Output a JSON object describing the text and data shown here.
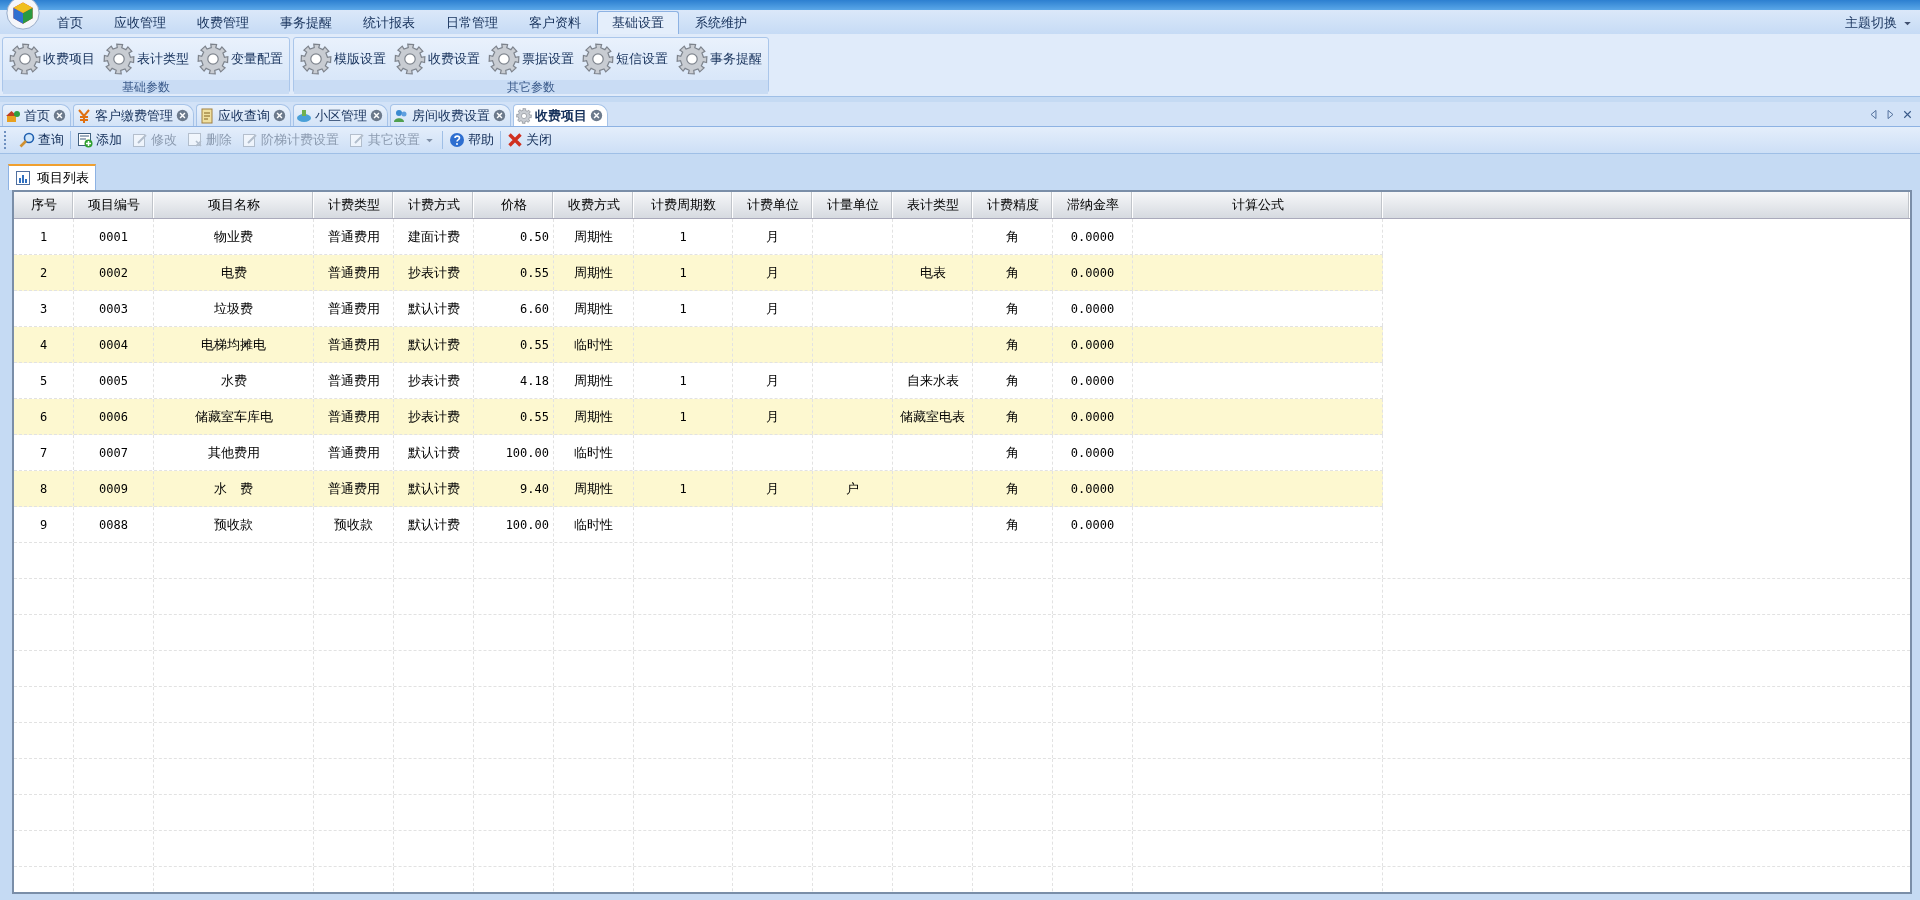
{
  "menu": {
    "tabs": [
      {
        "label": "首页",
        "selected": false
      },
      {
        "label": "应收管理",
        "selected": false
      },
      {
        "label": "收费管理",
        "selected": false
      },
      {
        "label": "事务提醒",
        "selected": false
      },
      {
        "label": "统计报表",
        "selected": false
      },
      {
        "label": "日常管理",
        "selected": false
      },
      {
        "label": "客户资料",
        "selected": false
      },
      {
        "label": "基础设置",
        "selected": true
      },
      {
        "label": "系统维护",
        "selected": false
      }
    ],
    "theme_switch": "主题切换"
  },
  "ribbon": {
    "groups": [
      {
        "label": "基础参数",
        "buttons": [
          {
            "label": "收费项目"
          },
          {
            "label": "表计类型"
          },
          {
            "label": "变量配置"
          }
        ]
      },
      {
        "label": "其它参数",
        "buttons": [
          {
            "label": "模版设置"
          },
          {
            "label": "收费设置"
          },
          {
            "label": "票据设置"
          },
          {
            "label": "短信设置"
          },
          {
            "label": "事务提醒"
          }
        ]
      }
    ]
  },
  "doc_tabs": [
    {
      "label": "首页",
      "selected": false
    },
    {
      "label": "客户缴费管理",
      "selected": false
    },
    {
      "label": "应收查询",
      "selected": false
    },
    {
      "label": "小区管理",
      "selected": false
    },
    {
      "label": "房间收费设置",
      "selected": false
    },
    {
      "label": "收费项目",
      "selected": true
    }
  ],
  "toolbar": [
    {
      "label": "查询",
      "disabled": false
    },
    {
      "label": "添加",
      "disabled": false
    },
    {
      "label": "修改",
      "disabled": true
    },
    {
      "label": "删除",
      "disabled": true
    },
    {
      "label": "阶梯计费设置",
      "disabled": true
    },
    {
      "label": "其它设置",
      "disabled": true,
      "dropdown": true
    },
    {
      "label": "帮助",
      "disabled": false
    },
    {
      "label": "关闭",
      "disabled": false
    }
  ],
  "panel_tab": {
    "label": "项目列表",
    "selected": true
  },
  "table": {
    "columns": [
      "序号",
      "项目编号",
      "项目名称",
      "计费类型",
      "计费方式",
      "价格",
      "收费方式",
      "计费周期数",
      "计费单位",
      "计量单位",
      "表计类型",
      "计费精度",
      "滞纳金率",
      "计算公式"
    ],
    "rows": [
      [
        "1",
        "0001",
        "物业费",
        "普通费用",
        "建面计费",
        "0.50",
        "周期性",
        "1",
        "月",
        null,
        null,
        "角",
        "0.0000",
        null
      ],
      [
        "2",
        "0002",
        "电费",
        "普通费用",
        "抄表计费",
        "0.55",
        "周期性",
        "1",
        "月",
        null,
        "电表",
        "角",
        "0.0000",
        null
      ],
      [
        "3",
        "0003",
        "垃圾费",
        "普通费用",
        "默认计费",
        "6.60",
        "周期性",
        "1",
        "月",
        null,
        null,
        "角",
        "0.0000",
        null
      ],
      [
        "4",
        "0004",
        "电梯均摊电",
        "普通费用",
        "默认计费",
        "0.55",
        "临时性",
        null,
        null,
        null,
        null,
        "角",
        "0.0000",
        null
      ],
      [
        "5",
        "0005",
        "水费",
        "普通费用",
        "抄表计费",
        "4.18",
        "周期性",
        "1",
        "月",
        null,
        "自来水表",
        "角",
        "0.0000",
        null
      ],
      [
        "6",
        "0006",
        "储藏室车库电",
        "普通费用",
        "抄表计费",
        "0.55",
        "周期性",
        "1",
        "月",
        null,
        "储藏室电表",
        "角",
        "0.0000",
        null
      ],
      [
        "7",
        "0007",
        "其他费用",
        "普通费用",
        "默认计费",
        "100.00",
        "临时性",
        null,
        null,
        null,
        null,
        "角",
        "0.0000",
        null
      ],
      [
        "8",
        "0009",
        "水　费",
        "普通费用",
        "默认计费",
        "9.40",
        "周期性",
        "1",
        "月",
        "户",
        null,
        "角",
        "0.0000",
        null
      ],
      [
        "9",
        "0088",
        "预收款",
        "预收款",
        "默认计费",
        "100.00",
        "临时性",
        null,
        null,
        null,
        null,
        "角",
        "0.0000",
        null
      ]
    ]
  }
}
